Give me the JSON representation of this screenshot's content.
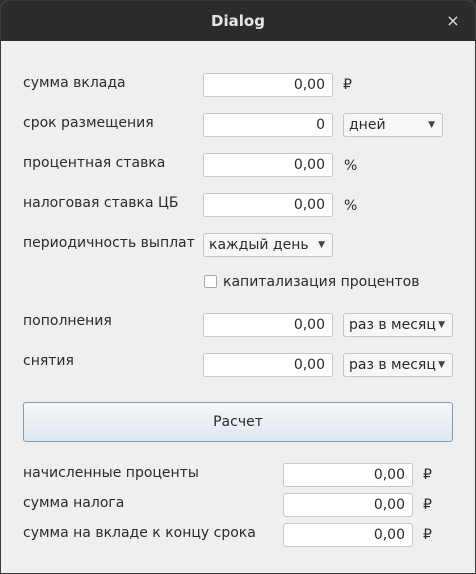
{
  "window": {
    "title": "Dialog",
    "close_glyph": "×"
  },
  "form": {
    "deposit_amount": {
      "label": "сумма вклада",
      "value": "0,00",
      "unit": "₽"
    },
    "term": {
      "label": "срок размещения",
      "value": "0",
      "period_selected": "дней"
    },
    "interest_rate": {
      "label": "процентная ставка",
      "value": "0,00",
      "unit": "%"
    },
    "cb_tax_rate": {
      "label": "налоговая ставка ЦБ",
      "value": "0,00",
      "unit": "%"
    },
    "payout_frequency": {
      "label": "периодичность выплат",
      "selected": "каждый день"
    },
    "capitalization": {
      "label": "капитализация процентов",
      "checked": false
    },
    "deposits": {
      "label": "пополнения",
      "value": "0,00",
      "frequency_selected": "раз в месяц"
    },
    "withdrawals": {
      "label": "снятия",
      "value": "0,00",
      "frequency_selected": "раз в месяц"
    }
  },
  "calculate_button": {
    "label": "Расчет"
  },
  "results": {
    "accrued_interest": {
      "label": "начисленные проценты",
      "value": "0,00",
      "unit": "₽"
    },
    "tax_amount": {
      "label": "сумма налога",
      "value": "0,00",
      "unit": "₽"
    },
    "final_balance": {
      "label": "сумма на вкладе к концу срока",
      "value": "0,00",
      "unit": "₽"
    }
  },
  "icons": {
    "dropdown": "chevron-down-icon",
    "close": "close-icon"
  },
  "colors": {
    "titlebar": "#2c2c2c",
    "window_bg": "#efefef",
    "button_border": "#7e9cb6"
  }
}
